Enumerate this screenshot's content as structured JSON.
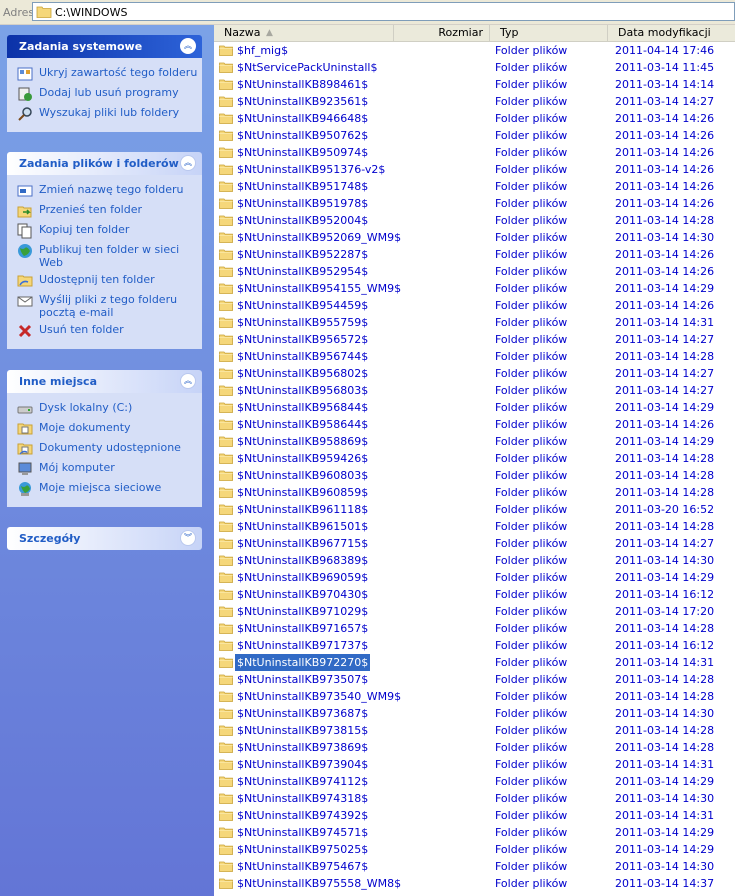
{
  "address": {
    "label": "Adres",
    "path": "C:\\WINDOWS"
  },
  "panels": {
    "system": {
      "title": "Zadania systemowe",
      "items": [
        {
          "label": "Ukryj zawartość tego folderu",
          "icon": "hide-contents-icon"
        },
        {
          "label": "Dodaj lub usuń programy",
          "icon": "add-remove-programs-icon"
        },
        {
          "label": "Wyszukaj pliki lub foldery",
          "icon": "search-icon"
        }
      ]
    },
    "files": {
      "title": "Zadania plików i folderów",
      "items": [
        {
          "label": "Zmień nazwę tego folderu",
          "icon": "rename-icon"
        },
        {
          "label": "Przenieś ten folder",
          "icon": "move-icon"
        },
        {
          "label": "Kopiuj ten folder",
          "icon": "copy-icon"
        },
        {
          "label": "Publikuj ten folder w sieci Web",
          "icon": "web-publish-icon"
        },
        {
          "label": "Udostępnij ten folder",
          "icon": "share-icon"
        },
        {
          "label": "Wyślij pliki z tego folderu pocztą e-mail",
          "icon": "email-icon"
        },
        {
          "label": "Usuń ten folder",
          "icon": "delete-icon"
        }
      ]
    },
    "places": {
      "title": "Inne miejsca",
      "items": [
        {
          "label": "Dysk lokalny (C:)",
          "icon": "local-disk-icon"
        },
        {
          "label": "Moje dokumenty",
          "icon": "my-documents-icon"
        },
        {
          "label": "Dokumenty udostępnione",
          "icon": "shared-documents-icon"
        },
        {
          "label": "Mój komputer",
          "icon": "my-computer-icon"
        },
        {
          "label": "Moje miejsca sieciowe",
          "icon": "network-places-icon"
        }
      ]
    },
    "details": {
      "title": "Szczegóły"
    }
  },
  "columns": {
    "name": "Nazwa",
    "size": "Rozmiar",
    "type": "Typ",
    "date": "Data modyfikacji"
  },
  "colors": {
    "link": "#215dc6",
    "file_text": "#0000cc",
    "selection": "#316ac5"
  },
  "files": [
    {
      "name": "$hf_mig$",
      "type": "Folder plików",
      "date": "2011-04-14 17:46"
    },
    {
      "name": "$NtServicePackUninstall$",
      "type": "Folder plików",
      "date": "2011-03-14 11:45"
    },
    {
      "name": "$NtUninstallKB898461$",
      "type": "Folder plików",
      "date": "2011-03-14 14:14"
    },
    {
      "name": "$NtUninstallKB923561$",
      "type": "Folder plików",
      "date": "2011-03-14 14:27"
    },
    {
      "name": "$NtUninstallKB946648$",
      "type": "Folder plików",
      "date": "2011-03-14 14:26"
    },
    {
      "name": "$NtUninstallKB950762$",
      "type": "Folder plików",
      "date": "2011-03-14 14:26"
    },
    {
      "name": "$NtUninstallKB950974$",
      "type": "Folder plików",
      "date": "2011-03-14 14:26"
    },
    {
      "name": "$NtUninstallKB951376-v2$",
      "type": "Folder plików",
      "date": "2011-03-14 14:26"
    },
    {
      "name": "$NtUninstallKB951748$",
      "type": "Folder plików",
      "date": "2011-03-14 14:26"
    },
    {
      "name": "$NtUninstallKB951978$",
      "type": "Folder plików",
      "date": "2011-03-14 14:26"
    },
    {
      "name": "$NtUninstallKB952004$",
      "type": "Folder plików",
      "date": "2011-03-14 14:28"
    },
    {
      "name": "$NtUninstallKB952069_WM9$",
      "type": "Folder plików",
      "date": "2011-03-14 14:30"
    },
    {
      "name": "$NtUninstallKB952287$",
      "type": "Folder plików",
      "date": "2011-03-14 14:26"
    },
    {
      "name": "$NtUninstallKB952954$",
      "type": "Folder plików",
      "date": "2011-03-14 14:26"
    },
    {
      "name": "$NtUninstallKB954155_WM9$",
      "type": "Folder plików",
      "date": "2011-03-14 14:29"
    },
    {
      "name": "$NtUninstallKB954459$",
      "type": "Folder plików",
      "date": "2011-03-14 14:26"
    },
    {
      "name": "$NtUninstallKB955759$",
      "type": "Folder plików",
      "date": "2011-03-14 14:31"
    },
    {
      "name": "$NtUninstallKB956572$",
      "type": "Folder plików",
      "date": "2011-03-14 14:27"
    },
    {
      "name": "$NtUninstallKB956744$",
      "type": "Folder plików",
      "date": "2011-03-14 14:28"
    },
    {
      "name": "$NtUninstallKB956802$",
      "type": "Folder plików",
      "date": "2011-03-14 14:27"
    },
    {
      "name": "$NtUninstallKB956803$",
      "type": "Folder plików",
      "date": "2011-03-14 14:27"
    },
    {
      "name": "$NtUninstallKB956844$",
      "type": "Folder plików",
      "date": "2011-03-14 14:29"
    },
    {
      "name": "$NtUninstallKB958644$",
      "type": "Folder plików",
      "date": "2011-03-14 14:26"
    },
    {
      "name": "$NtUninstallKB958869$",
      "type": "Folder plików",
      "date": "2011-03-14 14:29"
    },
    {
      "name": "$NtUninstallKB959426$",
      "type": "Folder plików",
      "date": "2011-03-14 14:28"
    },
    {
      "name": "$NtUninstallKB960803$",
      "type": "Folder plików",
      "date": "2011-03-14 14:28"
    },
    {
      "name": "$NtUninstallKB960859$",
      "type": "Folder plików",
      "date": "2011-03-14 14:28"
    },
    {
      "name": "$NtUninstallKB961118$",
      "type": "Folder plików",
      "date": "2011-03-20 16:52"
    },
    {
      "name": "$NtUninstallKB961501$",
      "type": "Folder plików",
      "date": "2011-03-14 14:28"
    },
    {
      "name": "$NtUninstallKB967715$",
      "type": "Folder plików",
      "date": "2011-03-14 14:27"
    },
    {
      "name": "$NtUninstallKB968389$",
      "type": "Folder plików",
      "date": "2011-03-14 14:30"
    },
    {
      "name": "$NtUninstallKB969059$",
      "type": "Folder plików",
      "date": "2011-03-14 14:29"
    },
    {
      "name": "$NtUninstallKB970430$",
      "type": "Folder plików",
      "date": "2011-03-14 16:12"
    },
    {
      "name": "$NtUninstallKB971029$",
      "type": "Folder plików",
      "date": "2011-03-14 17:20"
    },
    {
      "name": "$NtUninstallKB971657$",
      "type": "Folder plików",
      "date": "2011-03-14 14:28"
    },
    {
      "name": "$NtUninstallKB971737$",
      "type": "Folder plików",
      "date": "2011-03-14 16:12"
    },
    {
      "name": "$NtUninstallKB972270$",
      "type": "Folder plików",
      "date": "2011-03-14 14:31",
      "selected": true
    },
    {
      "name": "$NtUninstallKB973507$",
      "type": "Folder plików",
      "date": "2011-03-14 14:28"
    },
    {
      "name": "$NtUninstallKB973540_WM9$",
      "type": "Folder plików",
      "date": "2011-03-14 14:28"
    },
    {
      "name": "$NtUninstallKB973687$",
      "type": "Folder plików",
      "date": "2011-03-14 14:30"
    },
    {
      "name": "$NtUninstallKB973815$",
      "type": "Folder plików",
      "date": "2011-03-14 14:28"
    },
    {
      "name": "$NtUninstallKB973869$",
      "type": "Folder plików",
      "date": "2011-03-14 14:28"
    },
    {
      "name": "$NtUninstallKB973904$",
      "type": "Folder plików",
      "date": "2011-03-14 14:31"
    },
    {
      "name": "$NtUninstallKB974112$",
      "type": "Folder plików",
      "date": "2011-03-14 14:29"
    },
    {
      "name": "$NtUninstallKB974318$",
      "type": "Folder plików",
      "date": "2011-03-14 14:30"
    },
    {
      "name": "$NtUninstallKB974392$",
      "type": "Folder plików",
      "date": "2011-03-14 14:31"
    },
    {
      "name": "$NtUninstallKB974571$",
      "type": "Folder plików",
      "date": "2011-03-14 14:29"
    },
    {
      "name": "$NtUninstallKB975025$",
      "type": "Folder plików",
      "date": "2011-03-14 14:29"
    },
    {
      "name": "$NtUninstallKB975467$",
      "type": "Folder plików",
      "date": "2011-03-14 14:30"
    },
    {
      "name": "$NtUninstallKB975558_WM8$",
      "type": "Folder plików",
      "date": "2011-03-14 14:37"
    }
  ]
}
